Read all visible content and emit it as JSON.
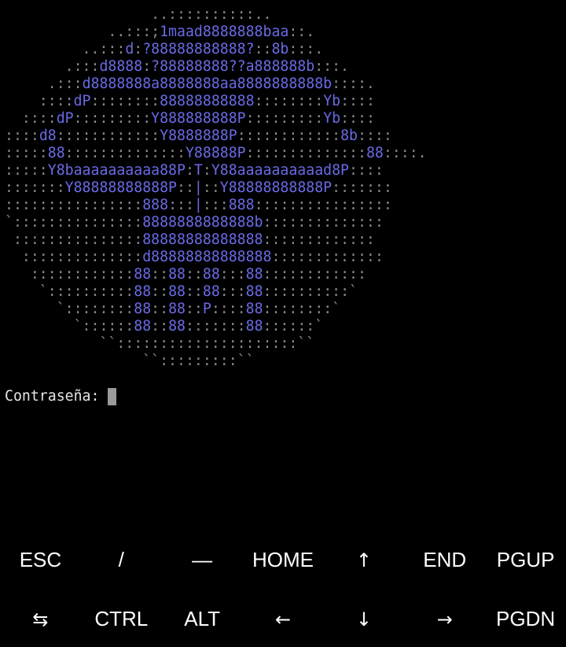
{
  "ascii_art": [
    [
      {
        "t": "                 ..::::::::::..",
        "c": "dots"
      }
    ],
    [
      {
        "t": "            ..:::;",
        "c": "dots"
      },
      {
        "t": "1maad8888888baa",
        "c": "logo"
      },
      {
        "t": "::.",
        "c": "dots"
      }
    ],
    [
      {
        "t": "         ..:::",
        "c": "dots"
      },
      {
        "t": "d",
        "c": "logo"
      },
      {
        "t": ":",
        "c": "dots"
      },
      {
        "t": "?88888888888?",
        "c": "logo"
      },
      {
        "t": "::",
        "c": "dots"
      },
      {
        "t": "8b",
        "c": "logo"
      },
      {
        "t": ":::.",
        "c": "dots"
      }
    ],
    [
      {
        "t": "       .:::",
        "c": "dots"
      },
      {
        "t": "d8888",
        "c": "logo"
      },
      {
        "t": ":",
        "c": "dots"
      },
      {
        "t": "?88888888??a888888b",
        "c": "logo"
      },
      {
        "t": ":::.",
        "c": "dots"
      }
    ],
    [
      {
        "t": "     .:::",
        "c": "dots"
      },
      {
        "t": "d8888888a8888888aa8888888888b",
        "c": "logo"
      },
      {
        "t": "::::.",
        "c": "dots"
      }
    ],
    [
      {
        "t": "    ::::",
        "c": "dots"
      },
      {
        "t": "dP",
        "c": "logo"
      },
      {
        "t": "::::::::",
        "c": "dots"
      },
      {
        "t": "88888888888",
        "c": "logo"
      },
      {
        "t": "::::::::",
        "c": "dots"
      },
      {
        "t": "Yb",
        "c": "logo"
      },
      {
        "t": "::::",
        "c": "dots"
      }
    ],
    [
      {
        "t": "  ::::",
        "c": "dots"
      },
      {
        "t": "dP",
        "c": "logo"
      },
      {
        "t": ":::::::::",
        "c": "dots"
      },
      {
        "t": "Y888888888P",
        "c": "logo"
      },
      {
        "t": ":::::::::",
        "c": "dots"
      },
      {
        "t": "Yb",
        "c": "logo"
      },
      {
        "t": "::::",
        "c": "dots"
      }
    ],
    [
      {
        "t": "::::",
        "c": "dots"
      },
      {
        "t": "d8",
        "c": "logo"
      },
      {
        "t": "::::::::::::",
        "c": "dots"
      },
      {
        "t": "Y8888888P",
        "c": "logo"
      },
      {
        "t": "::::::::::::",
        "c": "dots"
      },
      {
        "t": "8b",
        "c": "logo"
      },
      {
        "t": "::::",
        "c": "dots"
      }
    ],
    [
      {
        "t": ":::::",
        "c": "dots"
      },
      {
        "t": "88",
        "c": "logo"
      },
      {
        "t": "::::::::::::::",
        "c": "dots"
      },
      {
        "t": "Y88888P",
        "c": "logo"
      },
      {
        "t": "::::::::::::::",
        "c": "dots"
      },
      {
        "t": "88",
        "c": "logo"
      },
      {
        "t": "::::.",
        "c": "dots"
      }
    ],
    [
      {
        "t": ":::::",
        "c": "dots"
      },
      {
        "t": "Y8baaaaaaaaaa88P",
        "c": "logo"
      },
      {
        "t": ":",
        "c": "dots"
      },
      {
        "t": "T",
        "c": "logo"
      },
      {
        "t": ":",
        "c": "dots"
      },
      {
        "t": "Y88aaaaaaaaaad8P",
        "c": "logo"
      },
      {
        "t": "::::",
        "c": "dots"
      }
    ],
    [
      {
        "t": ":::::::",
        "c": "dots"
      },
      {
        "t": "Y88888888888P",
        "c": "logo"
      },
      {
        "t": "::",
        "c": "dots"
      },
      {
        "t": "|",
        "c": "logo"
      },
      {
        "t": "::",
        "c": "dots"
      },
      {
        "t": "Y88888888888P",
        "c": "logo"
      },
      {
        "t": ":::::::",
        "c": "dots"
      }
    ],
    [
      {
        "t": "::::::::::::::::",
        "c": "dots"
      },
      {
        "t": "888",
        "c": "logo"
      },
      {
        "t": ":::",
        "c": "dots"
      },
      {
        "t": "|",
        "c": "logo"
      },
      {
        "t": ":::",
        "c": "dots"
      },
      {
        "t": "888",
        "c": "logo"
      },
      {
        "t": "::::::::::::::::",
        "c": "dots"
      }
    ],
    [
      {
        "t": "`:::::::::::::::",
        "c": "dots"
      },
      {
        "t": "8888888888888b",
        "c": "logo"
      },
      {
        "t": "::::::::::::::",
        "c": "dots"
      }
    ],
    [
      {
        "t": " :::::::::::::::",
        "c": "dots"
      },
      {
        "t": "88888888888888",
        "c": "logo"
      },
      {
        "t": ":::::::::::::",
        "c": "dots"
      }
    ],
    [
      {
        "t": "  ::::::::::::::",
        "c": "dots"
      },
      {
        "t": "d88888888888888",
        "c": "logo"
      },
      {
        "t": ":::::::::::::",
        "c": "dots"
      }
    ],
    [
      {
        "t": "   ::::::::::::",
        "c": "dots"
      },
      {
        "t": "88",
        "c": "logo"
      },
      {
        "t": "::",
        "c": "dots"
      },
      {
        "t": "88",
        "c": "logo"
      },
      {
        "t": "::",
        "c": "dots"
      },
      {
        "t": "88",
        "c": "logo"
      },
      {
        "t": ":::",
        "c": "dots"
      },
      {
        "t": "88",
        "c": "logo"
      },
      {
        "t": "::::::::::::",
        "c": "dots"
      }
    ],
    [
      {
        "t": "    `::::::::::",
        "c": "dots"
      },
      {
        "t": "88",
        "c": "logo"
      },
      {
        "t": "::",
        "c": "dots"
      },
      {
        "t": "88",
        "c": "logo"
      },
      {
        "t": "::",
        "c": "dots"
      },
      {
        "t": "88",
        "c": "logo"
      },
      {
        "t": ":::",
        "c": "dots"
      },
      {
        "t": "88",
        "c": "logo"
      },
      {
        "t": "::::::::::`",
        "c": "dots"
      }
    ],
    [
      {
        "t": "      `::::::::",
        "c": "dots"
      },
      {
        "t": "88",
        "c": "logo"
      },
      {
        "t": "::",
        "c": "dots"
      },
      {
        "t": "88",
        "c": "logo"
      },
      {
        "t": "::",
        "c": "dots"
      },
      {
        "t": "P",
        "c": "logo"
      },
      {
        "t": "::::",
        "c": "dots"
      },
      {
        "t": "88",
        "c": "logo"
      },
      {
        "t": "::::::::`",
        "c": "dots"
      }
    ],
    [
      {
        "t": "        `::::::",
        "c": "dots"
      },
      {
        "t": "88",
        "c": "logo"
      },
      {
        "t": "::",
        "c": "dots"
      },
      {
        "t": "88",
        "c": "logo"
      },
      {
        "t": ":::::::",
        "c": "dots"
      },
      {
        "t": "88",
        "c": "logo"
      },
      {
        "t": "::::::`",
        "c": "dots"
      }
    ],
    [
      {
        "t": "           ``:::::::::::::::::::::``",
        "c": "dots"
      }
    ],
    [
      {
        "t": "                ``:::::::::``",
        "c": "dots"
      }
    ]
  ],
  "prompt": {
    "label": "Contraseña:"
  },
  "extra_keys": {
    "row1": [
      {
        "label": "ESC",
        "name": "esc-key"
      },
      {
        "label": "/",
        "name": "slash-key"
      },
      {
        "label": "—",
        "name": "dash-key"
      },
      {
        "label": "HOME",
        "name": "home-key"
      },
      {
        "label": "↑",
        "name": "arrow-up-key"
      },
      {
        "label": "END",
        "name": "end-key"
      },
      {
        "label": "PGUP",
        "name": "pgup-key"
      }
    ],
    "row2": [
      {
        "label": "⇆",
        "name": "tab-key"
      },
      {
        "label": "CTRL",
        "name": "ctrl-key"
      },
      {
        "label": "ALT",
        "name": "alt-key"
      },
      {
        "label": "←",
        "name": "arrow-left-key"
      },
      {
        "label": "↓",
        "name": "arrow-down-key"
      },
      {
        "label": "→",
        "name": "arrow-right-key"
      },
      {
        "label": "PGDN",
        "name": "pgdn-key"
      }
    ]
  },
  "colors": {
    "background": "#000000",
    "logo": "#6a6ae6",
    "dots": "#8a8a8a",
    "text": "#e6e6e6",
    "cursor": "#9a9a9a"
  }
}
